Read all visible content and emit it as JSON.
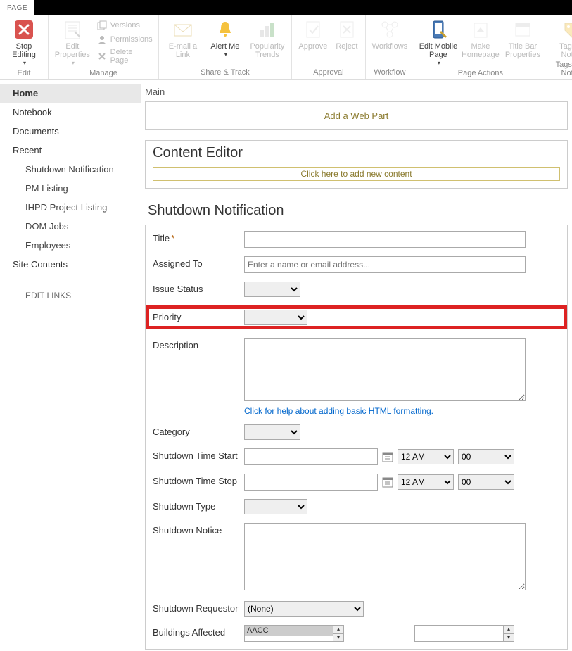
{
  "topbar": {
    "tab": "PAGE"
  },
  "ribbon": {
    "groups": {
      "edit": {
        "label": "Edit",
        "stop_editing": "Stop Editing"
      },
      "manage": {
        "label": "Manage",
        "edit_properties": "Edit Properties",
        "versions": "Versions",
        "permissions": "Permissions",
        "delete_page": "Delete Page"
      },
      "share_track": {
        "label": "Share & Track",
        "email": "E-mail a Link",
        "alert": "Alert Me",
        "popularity": "Popularity Trends"
      },
      "approval": {
        "label": "Approval",
        "approve": "Approve",
        "reject": "Reject"
      },
      "workflow": {
        "label": "Workflow",
        "workflows": "Workflows"
      },
      "page_actions": {
        "label": "Page Actions",
        "edit_mobile": "Edit Mobile Page",
        "make_homepage": "Make Homepage",
        "title_bar": "Title Bar Properties"
      },
      "tags_notes": {
        "label": "Tags and Notes",
        "tags": "Tags & Notes"
      }
    }
  },
  "sidebar": {
    "home": "Home",
    "notebook": "Notebook",
    "documents": "Documents",
    "recent": "Recent",
    "recent_items": {
      "shutdown_notification": "Shutdown Notification",
      "pm_listing": "PM Listing",
      "ihpd_project_listing": "IHPD Project Listing",
      "dom_jobs": "DOM Jobs",
      "employees": "Employees"
    },
    "site_contents": "Site Contents",
    "edit_links": "EDIT LINKS"
  },
  "content": {
    "breadcrumb": "Main",
    "add_webpart": "Add a Web Part",
    "content_editor": {
      "title": "Content Editor",
      "click_add": "Click here to add new content"
    },
    "form": {
      "title": "Shutdown Notification",
      "labels": {
        "title": "Title",
        "assigned_to": "Assigned To",
        "issue_status": "Issue Status",
        "priority": "Priority",
        "description": "Description",
        "category": "Category",
        "time_start": "Shutdown Time Start",
        "time_stop": "Shutdown Time Stop",
        "shutdown_type": "Shutdown Type",
        "shutdown_notice": "Shutdown Notice",
        "shutdown_requestor": "Shutdown Requestor",
        "buildings_affected": "Buildings Affected"
      },
      "placeholders": {
        "assigned_to": "Enter a name or email address..."
      },
      "description_help": "Click for help about adding basic HTML formatting.",
      "time_am": "12 AM",
      "time_min": "00",
      "requestor_none": "(None)",
      "buildings_first": "AACC"
    }
  }
}
